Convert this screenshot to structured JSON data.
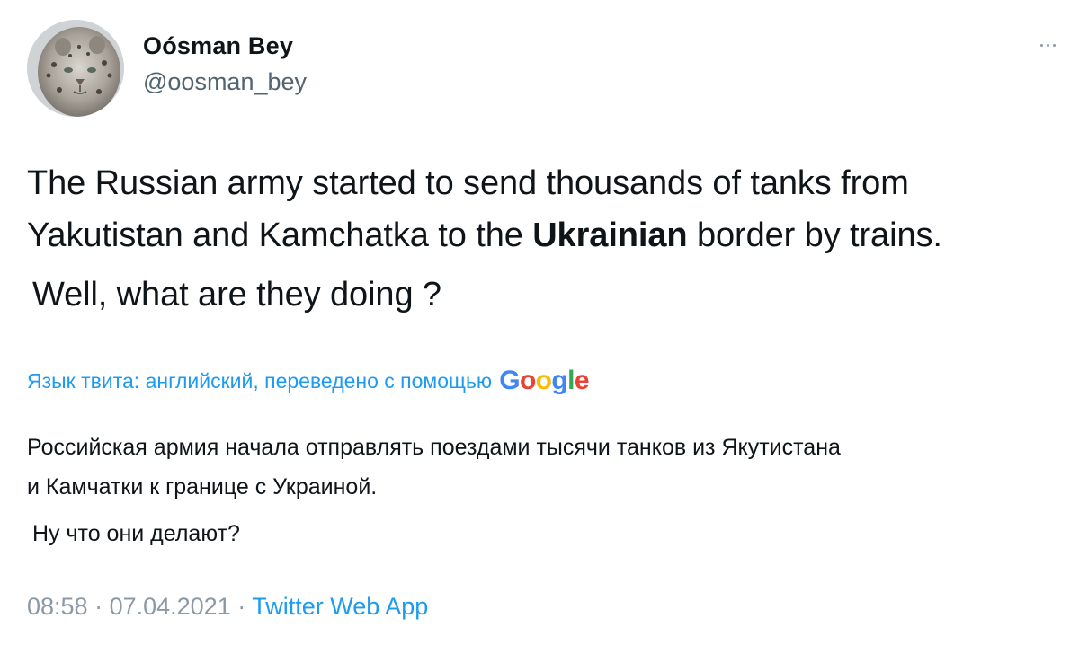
{
  "author": {
    "name": "Oósman Bey",
    "handle": "@oosman_bey",
    "avatar_icon": "snow-leopard-avatar"
  },
  "menu": {
    "icon": "more-horizontal-icon"
  },
  "tweet": {
    "line_1": "The Russian army started to send thousands of tanks from",
    "line_2_before": "Yakutistan and Kamchatka to the ",
    "line_2_bold": "Ukrainian",
    "line_2_after": " border by trains.",
    "line_3": "Well, what are they doing ?"
  },
  "translation": {
    "label": "Язык твита: английский, переведено с помощью",
    "provider": {
      "g1": "G",
      "o1": "o",
      "o2": "o",
      "g2": "g",
      "l": "l",
      "e": "e"
    },
    "line_1": "Российская армия начала отправлять поездами тысячи танков из Якутистана",
    "line_2": "и Камчатки к границе с Украиной.",
    "line_3": "Ну что они делают?"
  },
  "meta": {
    "time": "08:58",
    "separator_1": " · ",
    "date": "07.04.2021",
    "separator_2": " · ",
    "source": "Twitter Web App"
  },
  "colors": {
    "link": "#1d9bf0",
    "secondary": "#536471",
    "text": "#0f1419",
    "google_blue": "#4285f4",
    "google_red": "#ea4335",
    "google_yellow": "#fbbc05",
    "google_green": "#34a853"
  }
}
